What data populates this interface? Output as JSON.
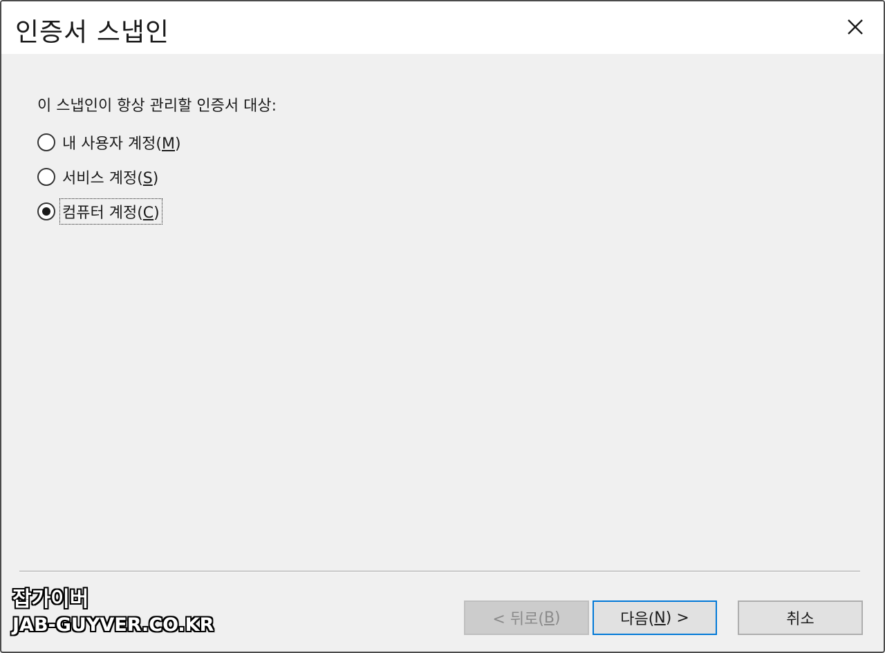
{
  "window": {
    "title": "인증서 스냅인",
    "close_icon": "close-icon"
  },
  "content": {
    "prompt": "이 스냅인이 항상 관리할 인증서 대상:",
    "options": [
      {
        "text": "내 사용자 계정(",
        "mnemonic": "M",
        "close": ")",
        "checked": false
      },
      {
        "text": "서비스 계정(",
        "mnemonic": "S",
        "close": ")",
        "checked": false
      },
      {
        "text": "컴퓨터 계정(",
        "mnemonic": "C",
        "close": ")",
        "checked": true
      }
    ]
  },
  "buttons": {
    "back": {
      "prefix": "< 뒤로(",
      "mnemonic": "B",
      "suffix": ")"
    },
    "next": {
      "prefix": "다음(",
      "mnemonic": "N",
      "suffix": ") >"
    },
    "cancel": {
      "label": "취소"
    }
  },
  "watermark": {
    "line1": "잡가이버",
    "line2": "JAB-GUYVER.CO.KR"
  },
  "colors": {
    "accent": "#0078d7",
    "dialog_bg": "#f0f0f0"
  }
}
